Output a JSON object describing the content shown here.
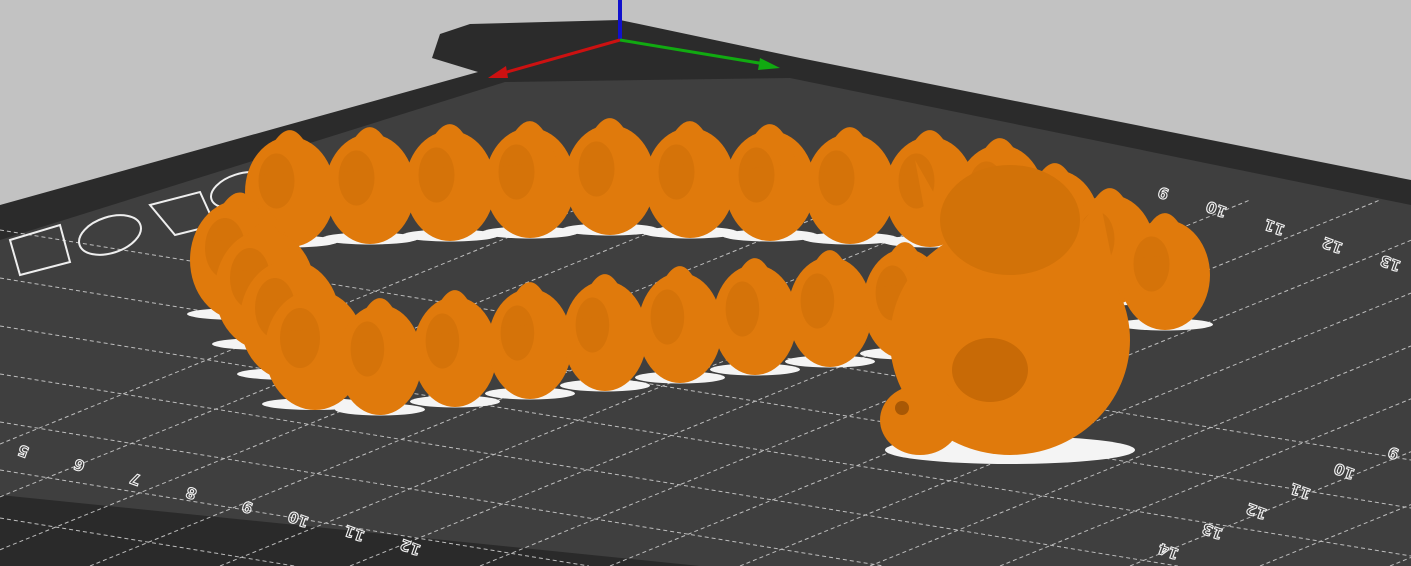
{
  "viewport": {
    "background_color": "#c2c2c2",
    "bed_border_color": "#2b2b2b",
    "bed_color": "#3f3f3f",
    "model_color": "#e07a0c",
    "axis_colors": {
      "x": "#cc1111",
      "y": "#11aa11",
      "z": "#1111cc"
    }
  },
  "bed": {
    "labels_left": [
      "5",
      "6",
      "7",
      "8",
      "9",
      "10",
      "11",
      "12"
    ],
    "labels_right_bottom": [
      "14",
      "13",
      "12",
      "11",
      "10",
      "9"
    ],
    "labels_top_right": [
      "9",
      "10",
      "11",
      "12",
      "13"
    ]
  }
}
